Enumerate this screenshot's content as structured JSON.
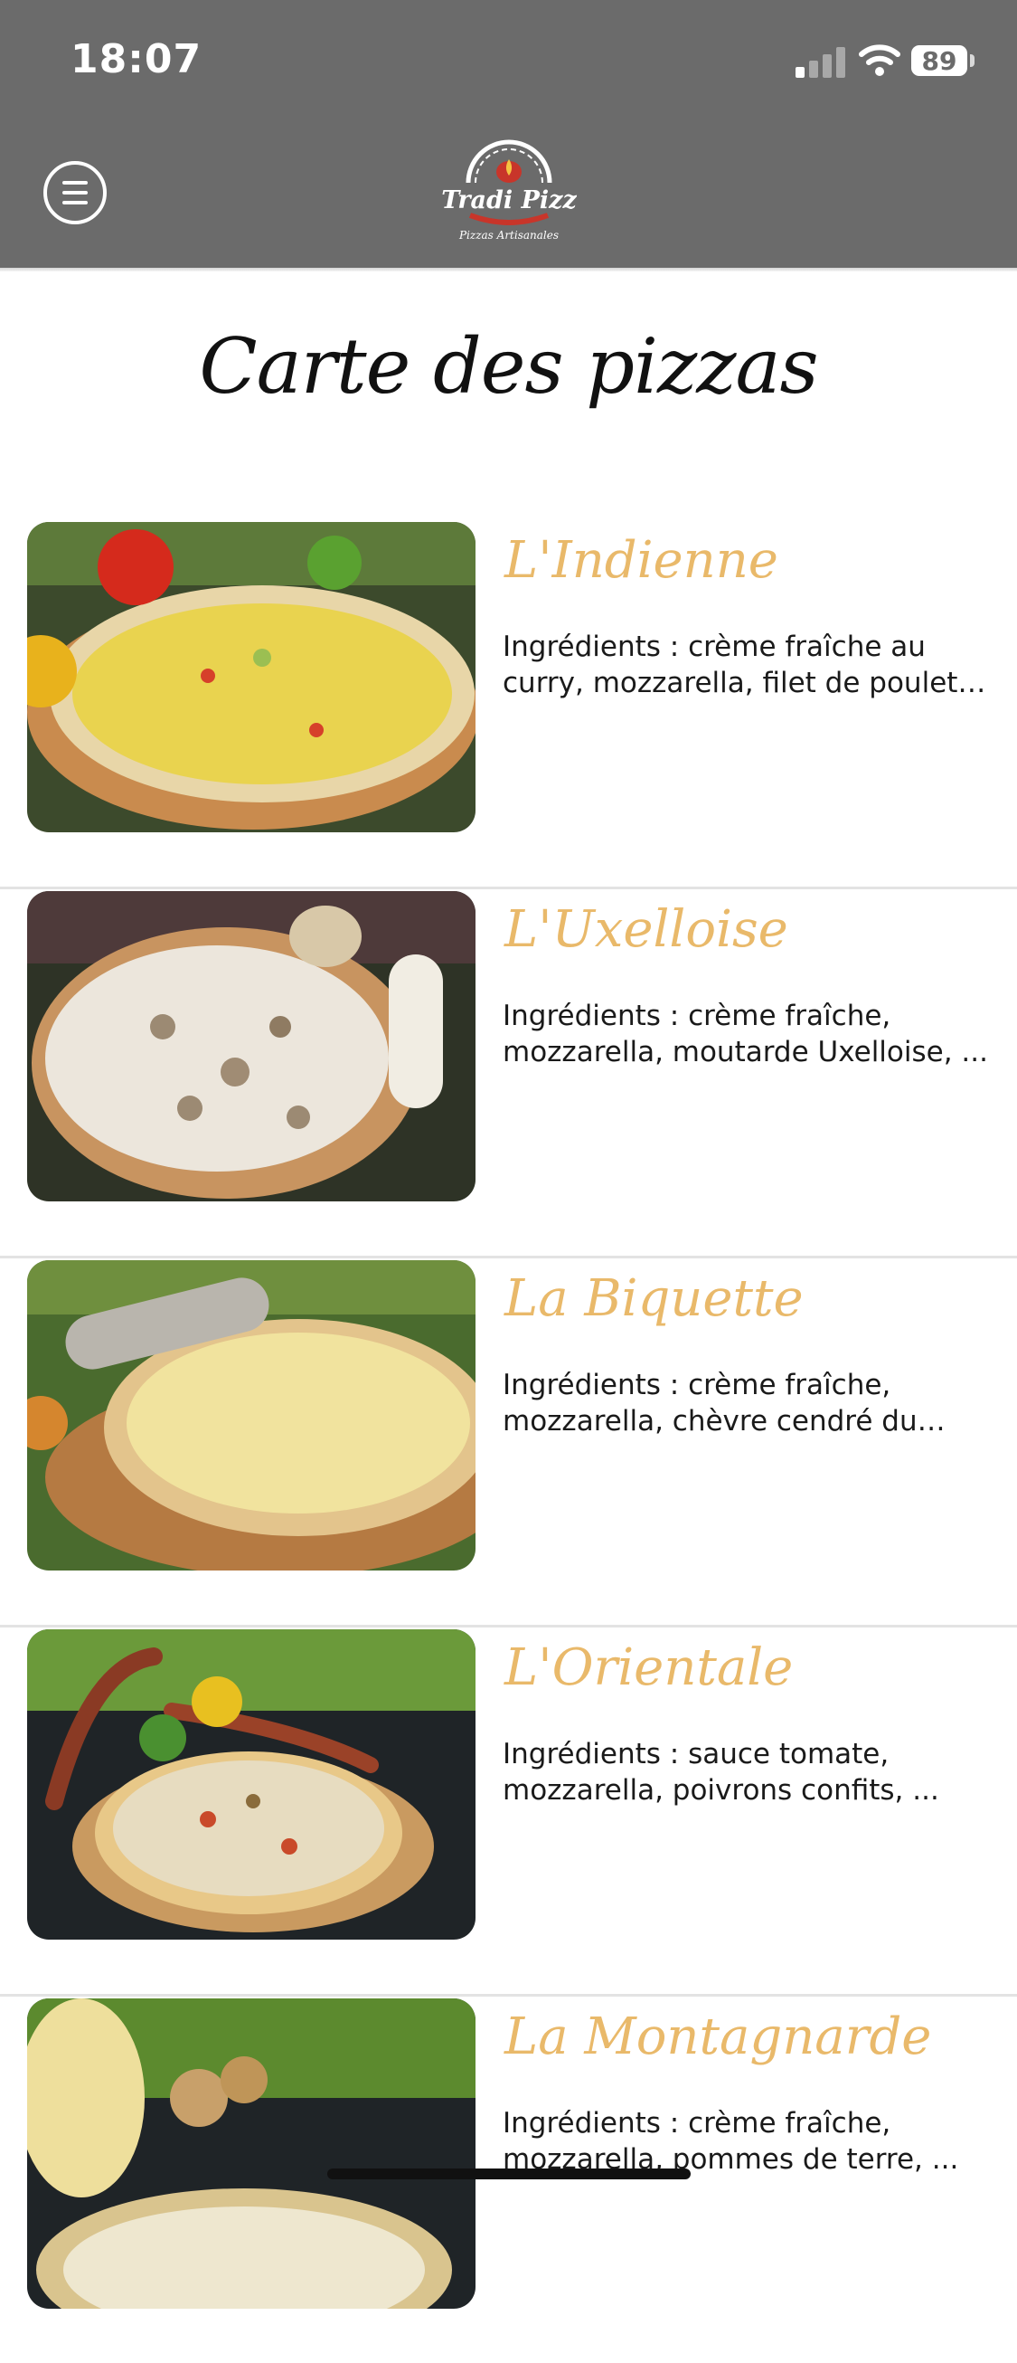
{
  "status_bar": {
    "time": "18:07",
    "battery": "89"
  },
  "header": {
    "logo_text": "Tradi Pizz",
    "logo_subtext": "Pizzas Artisanales"
  },
  "page": {
    "title": "Carte des pizzas"
  },
  "pizzas": [
    {
      "name": "L'Indienne",
      "description": "Ingrédients : crème fraîche au curry, mozzarella, filet de poulet, poivrons, ..."
    },
    {
      "name": "L'Uxelloise",
      "description": "Ingrédients : crème fraîche, mozzarella, moutarde Uxelloise, ..."
    },
    {
      "name": "La Biquette",
      "description": "Ingrédients : crème fraîche, mozzarella, chèvre cendré du Loir-..."
    },
    {
      "name": "L'Orientale",
      "description": "Ingrédients : sauce tomate, mozzarella, poivrons confits, ..."
    },
    {
      "name": "La Montagnarde",
      "description": "Ingrédients : crème fraîche, mozzarella, pommes de terre, ..."
    }
  ],
  "colors": {
    "header_bg": "#6b6b6b",
    "accent_gold": "#e9b96a",
    "logo_red": "#c8352a"
  },
  "icons": [
    "menu-icon",
    "signal-icon",
    "wifi-icon",
    "battery-icon"
  ]
}
